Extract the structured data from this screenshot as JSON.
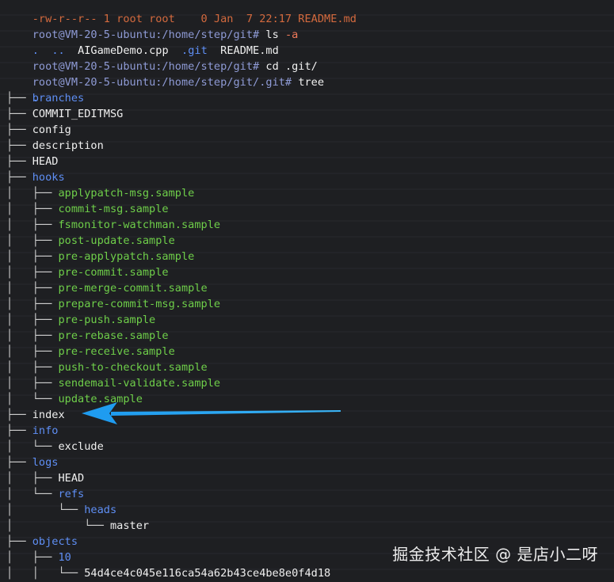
{
  "terminal": {
    "partial_top_line": "-rw-r--r-- 1 root root    0 Jan  7 22:17 README.md",
    "lines": [
      {
        "prompt": "root@VM-20-5-ubuntu:/home/step/git#",
        "cmd": "ls",
        "arg": "-a"
      },
      {
        "listing": [
          ".",
          "..",
          "AIGameDemo.cpp",
          ".git",
          "README.md"
        ]
      },
      {
        "prompt": "root@VM-20-5-ubuntu:/home/step/git#",
        "cmd": "cd .git/",
        "arg": ""
      },
      {
        "prompt": "root@VM-20-5-ubuntu:/home/step/git/.git#",
        "cmd": "tree",
        "arg": ""
      }
    ],
    "tree_root": ".",
    "tree": [
      {
        "prefix": "├── ",
        "name": "branches",
        "kind": "dir"
      },
      {
        "prefix": "├── ",
        "name": "COMMIT_EDITMSG",
        "kind": "file"
      },
      {
        "prefix": "├── ",
        "name": "config",
        "kind": "file"
      },
      {
        "prefix": "├── ",
        "name": "description",
        "kind": "file"
      },
      {
        "prefix": "├── ",
        "name": "HEAD",
        "kind": "file"
      },
      {
        "prefix": "├── ",
        "name": "hooks",
        "kind": "dir"
      },
      {
        "prefix": "│   ├── ",
        "name": "applypatch-msg.sample",
        "kind": "exe"
      },
      {
        "prefix": "│   ├── ",
        "name": "commit-msg.sample",
        "kind": "exe"
      },
      {
        "prefix": "│   ├── ",
        "name": "fsmonitor-watchman.sample",
        "kind": "exe"
      },
      {
        "prefix": "│   ├── ",
        "name": "post-update.sample",
        "kind": "exe"
      },
      {
        "prefix": "│   ├── ",
        "name": "pre-applypatch.sample",
        "kind": "exe"
      },
      {
        "prefix": "│   ├── ",
        "name": "pre-commit.sample",
        "kind": "exe"
      },
      {
        "prefix": "│   ├── ",
        "name": "pre-merge-commit.sample",
        "kind": "exe"
      },
      {
        "prefix": "│   ├── ",
        "name": "prepare-commit-msg.sample",
        "kind": "exe"
      },
      {
        "prefix": "│   ├── ",
        "name": "pre-push.sample",
        "kind": "exe"
      },
      {
        "prefix": "│   ├── ",
        "name": "pre-rebase.sample",
        "kind": "exe"
      },
      {
        "prefix": "│   ├── ",
        "name": "pre-receive.sample",
        "kind": "exe"
      },
      {
        "prefix": "│   ├── ",
        "name": "push-to-checkout.sample",
        "kind": "exe"
      },
      {
        "prefix": "│   ├── ",
        "name": "sendemail-validate.sample",
        "kind": "exe"
      },
      {
        "prefix": "│   └── ",
        "name": "update.sample",
        "kind": "exe"
      },
      {
        "prefix": "├── ",
        "name": "index",
        "kind": "file"
      },
      {
        "prefix": "├── ",
        "name": "info",
        "kind": "dir"
      },
      {
        "prefix": "│   └── ",
        "name": "exclude",
        "kind": "file"
      },
      {
        "prefix": "├── ",
        "name": "logs",
        "kind": "dir"
      },
      {
        "prefix": "│   ├── ",
        "name": "HEAD",
        "kind": "file"
      },
      {
        "prefix": "│   └── ",
        "name": "refs",
        "kind": "dir"
      },
      {
        "prefix": "│       └── ",
        "name": "heads",
        "kind": "dir"
      },
      {
        "prefix": "│           └── ",
        "name": "master",
        "kind": "file"
      },
      {
        "prefix": "├── ",
        "name": "objects",
        "kind": "dir"
      },
      {
        "prefix": "│   ├── ",
        "name": "10",
        "kind": "dir"
      },
      {
        "prefix": "│   │   └── ",
        "name": "54d4ce4c045e116ca54a62b43ce4be8e0f4d18",
        "kind": "file"
      }
    ]
  },
  "annotation": {
    "arrow_color": "#2aa7f0",
    "arrow_target": "index"
  },
  "watermark": "掘金技术社区 @ 是店小二呀",
  "colors": {
    "background": "#1e1f22",
    "prompt": "#8f9bd6",
    "directory": "#5f8ff5",
    "executable": "#6fcf4a",
    "flag": "#f07a5a"
  }
}
